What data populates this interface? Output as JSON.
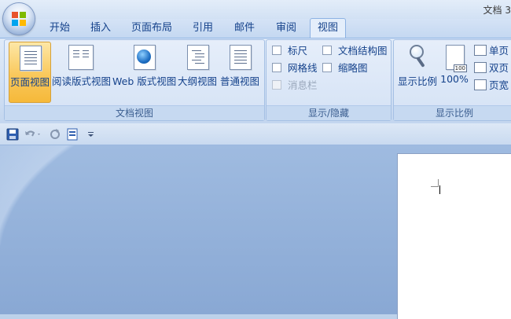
{
  "window": {
    "title": "文档 3"
  },
  "tabs": [
    {
      "label": "开始"
    },
    {
      "label": "插入"
    },
    {
      "label": "页面布局"
    },
    {
      "label": "引用"
    },
    {
      "label": "邮件"
    },
    {
      "label": "审阅"
    },
    {
      "label": "视图",
      "active": true
    }
  ],
  "ribbon": {
    "doc_views": {
      "label": "文档视图",
      "buttons": [
        {
          "label": "页面视图",
          "active": true
        },
        {
          "label": "阅读版式视图"
        },
        {
          "label": "Web 版式视图"
        },
        {
          "label": "大纲视图"
        },
        {
          "label": "普通视图"
        }
      ]
    },
    "show_hide": {
      "label": "显示/隐藏",
      "checkboxes": [
        {
          "label": "标尺"
        },
        {
          "label": "网格线"
        },
        {
          "label": "消息栏",
          "disabled": true
        },
        {
          "label": "文档结构图"
        },
        {
          "label": "缩略图"
        }
      ]
    },
    "zoom": {
      "label": "显示比例",
      "zoom_button": "显示比例",
      "percent_button": "100%",
      "percent_icon_text": "100",
      "one_page": "单页",
      "two_pages": "双页",
      "page_width": "页宽"
    }
  },
  "colors": {
    "accent": "#15428b",
    "active_tab_bg": "#e4eefb",
    "active_button": "#f9c85b"
  }
}
